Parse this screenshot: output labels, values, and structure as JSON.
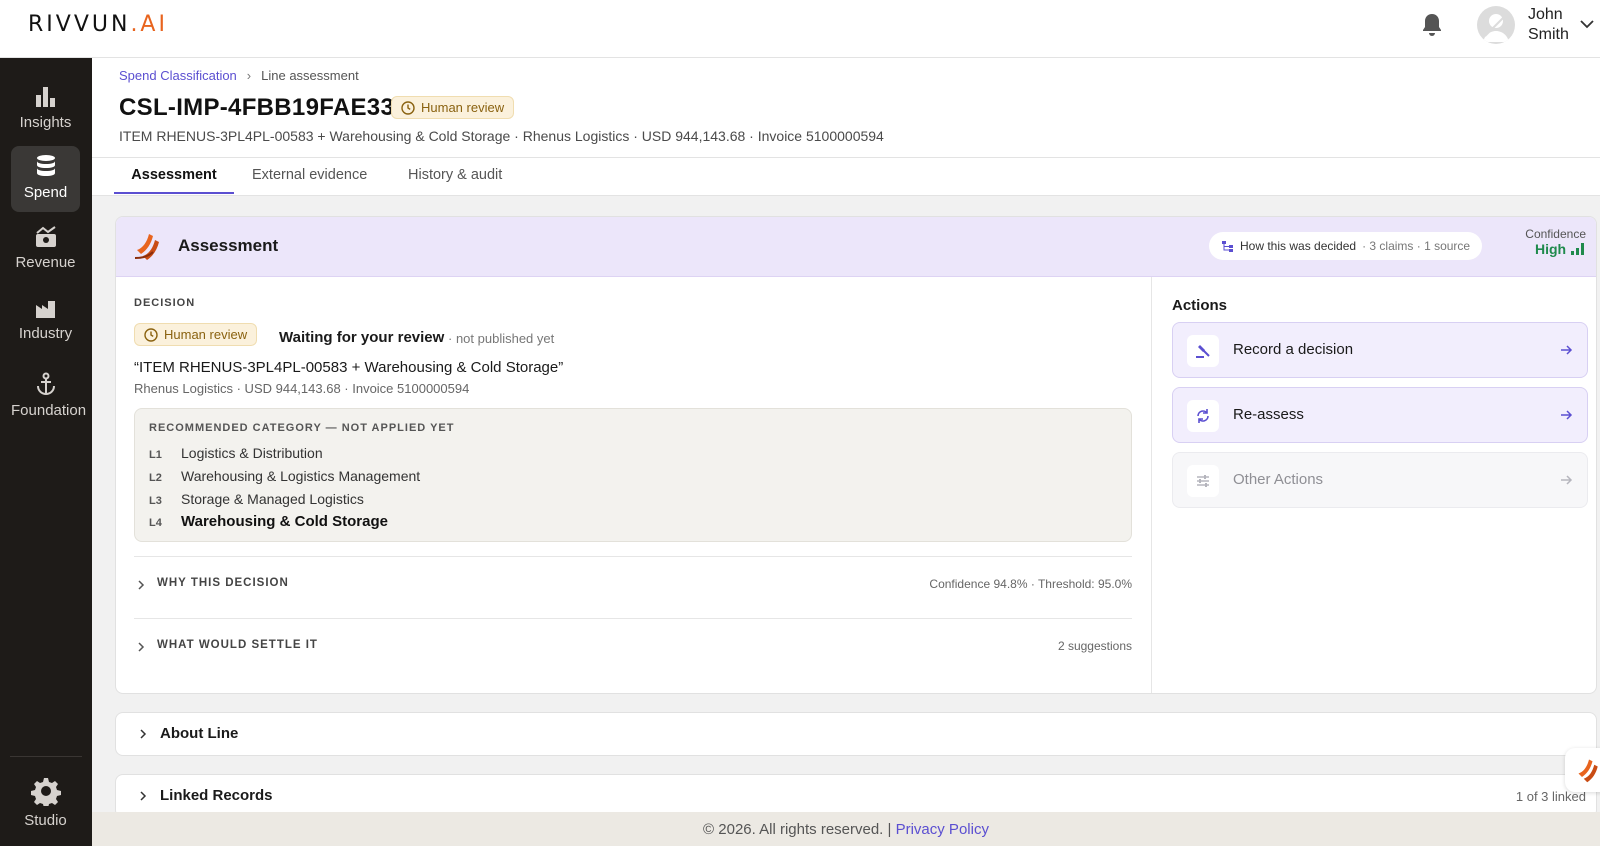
{
  "brand": {
    "name": "RIVVUN",
    "suffix": ".AI"
  },
  "user": {
    "first": "John",
    "last": "Smith"
  },
  "sidebar": {
    "items": [
      {
        "label": "Insights",
        "icon": "bar-chart-icon"
      },
      {
        "label": "Spend",
        "icon": "database-icon"
      },
      {
        "label": "Revenue",
        "icon": "revenue-icon"
      },
      {
        "label": "Industry",
        "icon": "factory-icon"
      },
      {
        "label": "Foundation",
        "icon": "anchor-icon"
      },
      {
        "label": "Studio",
        "icon": "gear-icon"
      }
    ]
  },
  "breadcrumb": {
    "parent": "Spend Classification",
    "current": "Line assessment"
  },
  "header": {
    "title": "CSL-IMP-4FBB19FAE331",
    "badge": "Human review",
    "subtitle": "ITEM RHENUS-3PL4PL-00583 + Warehousing & Cold Storage · Rhenus Logistics · USD 944,143.68 · Invoice 5100000594"
  },
  "tabs": [
    "Assessment",
    "External evidence",
    "History & audit"
  ],
  "assessment": {
    "title": "Assessment",
    "how_decided": "How this was decided",
    "how_meta": "· 3 claims · 1 source",
    "confidence_label": "Confidence",
    "confidence_value": "High",
    "decision_label": "DECISION",
    "decision_badge": "Human review",
    "waiting": "Waiting for your review",
    "not_published": "· not published yet",
    "quote": "“ITEM RHENUS-3PL4PL-00583 + Warehousing & Cold Storage”",
    "quote_sub": "Rhenus Logistics · USD 944,143.68 · Invoice 5100000594",
    "recommended_title": "RECOMMENDED CATEGORY — NOT APPLIED YET",
    "levels": [
      {
        "level": "L1",
        "name": "Logistics & Distribution"
      },
      {
        "level": "L2",
        "name": "Warehousing & Logistics Management"
      },
      {
        "level": "L3",
        "name": "Storage & Managed Logistics"
      },
      {
        "level": "L4",
        "name": "Warehousing & Cold Storage"
      }
    ],
    "why_label": "WHY THIS DECISION",
    "why_meta": "Confidence 94.8% · Threshold: 95.0%",
    "settle_label": "WHAT WOULD SETTLE IT",
    "settle_meta": "2 suggestions"
  },
  "actions": {
    "title": "Actions",
    "items": [
      {
        "label": "Record a decision",
        "icon": "gavel-icon"
      },
      {
        "label": "Re-assess",
        "icon": "refresh-icon"
      },
      {
        "label": "Other Actions",
        "icon": "sliders-icon"
      }
    ]
  },
  "sections": {
    "about": "About Line",
    "linked": "Linked Records",
    "linked_meta": "1 of 3 linked"
  },
  "footer": {
    "text": "© 2026. All rights reserved. |",
    "link": "Privacy Policy"
  },
  "colors": {
    "accent": "#5b4fd1",
    "brand_orange": "#e8641e",
    "sidebar_bg": "#1e1b18",
    "confidence_green": "#1f8a4c",
    "badge_bg": "#fbf1dc"
  }
}
